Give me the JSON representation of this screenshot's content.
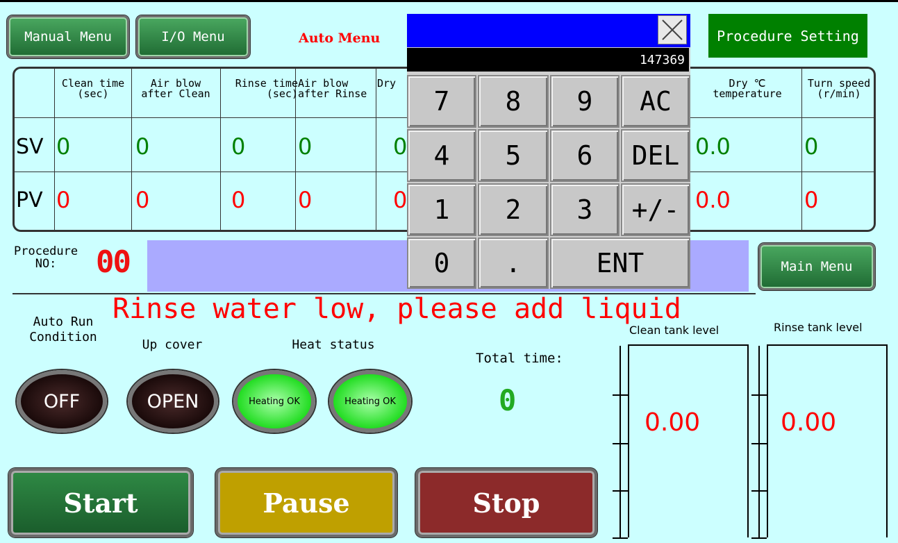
{
  "menu": {
    "manual": "Manual Menu",
    "io": "I/O Menu",
    "auto": "Auto Menu",
    "procedure_setting": "Procedure Setting",
    "main": "Main Menu"
  },
  "table": {
    "headers": [
      "Clean time\n(sec)",
      "Air blow\nafter Clean",
      "Rinse time\n(sec)",
      "Air blow\nafter Rinse",
      "Dry",
      "Dry ℃\ntemperature",
      "Turn speed\n(r/min)"
    ],
    "row_labels": {
      "sv": "SV",
      "pv": "PV"
    },
    "sv": [
      "0",
      "0",
      "0",
      "0",
      "0",
      "0.0",
      "0"
    ],
    "pv": [
      "0",
      "0",
      "0",
      "0",
      "0",
      "0.0",
      "0"
    ]
  },
  "procedure": {
    "label": "Procedure\nNO:",
    "number": "00"
  },
  "alarm": "Rinse water low, please add liquid",
  "status": {
    "auto_run_label": "Auto Run\nCondition",
    "auto_run_state": "OFF",
    "up_cover_label": "Up cover",
    "up_cover_state": "OPEN",
    "heat_label": "Heat status",
    "heat_states": [
      "Heating OK",
      "Heating OK"
    ]
  },
  "total_time": {
    "label": "Total time:",
    "value": "0"
  },
  "tanks": {
    "clean": {
      "label": "Clean tank level",
      "value": "0.00"
    },
    "rinse": {
      "label": "Rinse tank level",
      "value": "0.00"
    }
  },
  "buttons": {
    "start": "Start",
    "pause": "Pause",
    "stop": "Stop"
  },
  "keypad": {
    "display": "147369",
    "keys": [
      "7",
      "8",
      "9",
      "AC",
      "4",
      "5",
      "6",
      "DEL",
      "1",
      "2",
      "3",
      "+/-",
      "0",
      ".",
      "ENT"
    ]
  },
  "colors": {
    "background": "#ccffff",
    "sv": "#008000",
    "pv": "#ff0000",
    "alarm": "#ff0000",
    "keypad_title": "#0000ff"
  }
}
